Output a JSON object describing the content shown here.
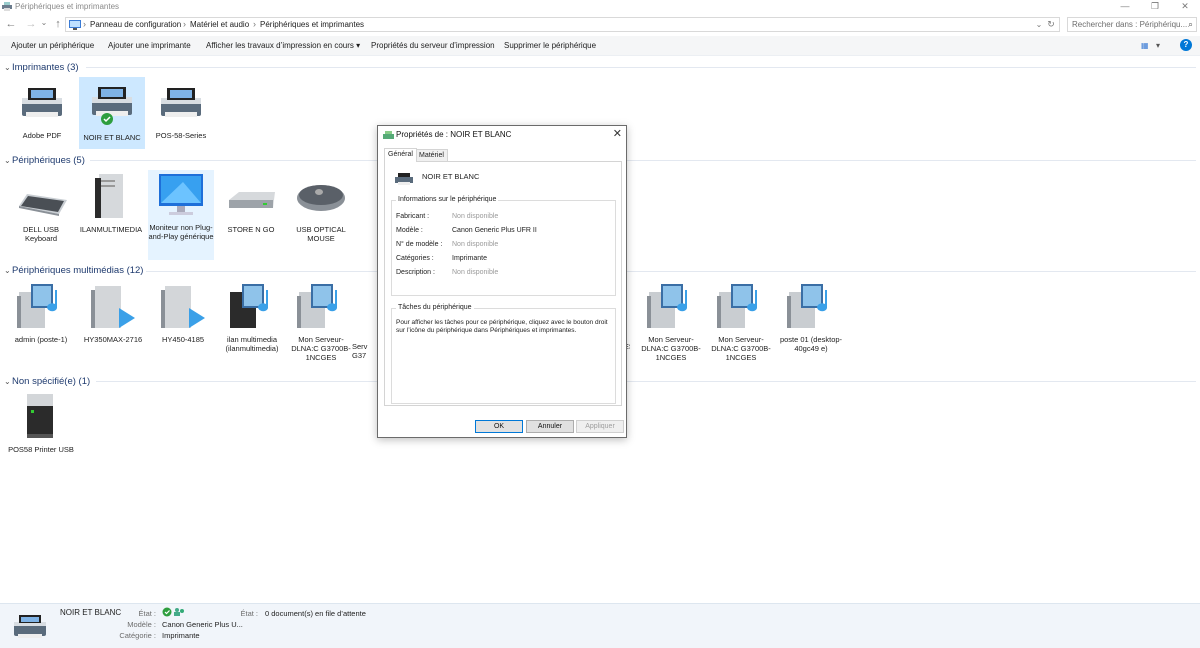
{
  "window": {
    "title": "Périphériques et imprimantes",
    "minimize": "—",
    "maximize": "❐",
    "close": "✕"
  },
  "nav": {
    "back": "←",
    "forward": "→",
    "recent": "⌄",
    "up": "↑",
    "dropdown": "⌄",
    "refresh": "↻"
  },
  "breadcrumb": [
    "Panneau de configuration",
    "Matériel et audio",
    "Périphériques et imprimantes"
  ],
  "search": {
    "placeholder": "Rechercher dans : Périphériqu...",
    "icon": "search-icon"
  },
  "commands": [
    "Ajouter un périphérique",
    "Ajouter une imprimante",
    "Afficher les travaux d’impression en cours ▾",
    "Propriétés du serveur d’impression",
    "Supprimer le périphérique"
  ],
  "view_icons": {
    "view": "▦",
    "arrow": "▾",
    "help": "?"
  },
  "groups": {
    "printers": {
      "title": "Imprimantes (3)",
      "items": [
        "Adobe PDF",
        "NOIR ET BLANC",
        "POS-58-Series"
      ]
    },
    "devices": {
      "title": "Périphériques (5)",
      "items": [
        "DELL USB Keyboard",
        "ILANMULTIMEDIA",
        "Moniteur non Plug-and-Play générique",
        "STORE N GO",
        "USB OPTICAL MOUSE"
      ]
    },
    "multimedia": {
      "title": "Périphériques multimédias (12)",
      "items": [
        "admin (poste-1)",
        "HY350MAX-2716",
        "HY450-4185",
        "ilan multimedia (ilanmultimedia)",
        "Mon Serveur-DLNA:C G3700B-1NCGES",
        "Serv G37",
        "GES",
        "Mon Serveur-DLNA:C G3700B-1NCGES",
        "Mon Serveur-DLNA:C G3700B-1NCGES",
        "poste 01 (desktop-40gc49 e)"
      ]
    },
    "unspecified": {
      "title": "Non spécifié(e) (1)",
      "items": [
        "POS58 Printer USB"
      ]
    }
  },
  "dialog": {
    "title": "Propriétés de : NOIR ET BLANC",
    "close": "✕",
    "tabs": [
      "Général",
      "Matériel"
    ],
    "device_name": "NOIR ET BLANC",
    "info_legend": "Informations sur le périphérique",
    "info": [
      {
        "k": "Fabricant :",
        "v": "Non disponible"
      },
      {
        "k": "Modèle :",
        "v": "Canon Generic Plus UFR II"
      },
      {
        "k": "N° de modèle :",
        "v": "Non disponible"
      },
      {
        "k": "Catégories :",
        "v": "Imprimante"
      },
      {
        "k": "Description :",
        "v": "Non disponible"
      }
    ],
    "tasks_legend": "Tâches du périphérique",
    "tasks_text": "Pour afficher les tâches pour ce périphérique, cliquez avec le bouton droit sur l’icône du périphérique dans Périphériques et imprimantes.",
    "buttons": {
      "ok": "OK",
      "cancel": "Annuler",
      "apply": "Appliquer"
    }
  },
  "details": {
    "name": "NOIR ET BLANC",
    "state_label": "État :",
    "state2_label": "État :",
    "state2_value": "0 document(s) en file d’attente",
    "model_label": "Modèle :",
    "model_value": "Canon Generic Plus U...",
    "category_label": "Catégorie :",
    "category_value": "Imprimante"
  },
  "colors": {
    "accent": "#0078d7",
    "selection": "#cde8ff",
    "group_title": "#1e3a6e",
    "check": "#2e9e3e"
  }
}
